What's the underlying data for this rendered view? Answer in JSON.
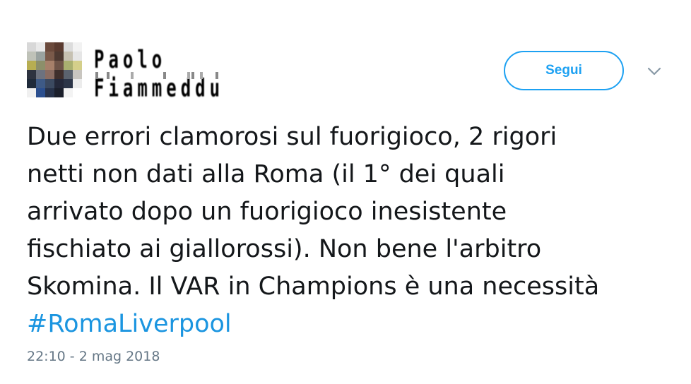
{
  "tweet": {
    "author_name": "Paolo Fiammeddu",
    "follow_label": "Segui",
    "text_lines": [
      "Due errori clamorosi sul fuorigioco, 2 rigori",
      "netti non dati alla Roma (il 1° dei quali",
      "arrivato dopo un fuorigioco inesistente",
      "fischiato ai giallorossi). Non bene l'arbitro",
      "Skomina. Il VAR in Champions è una necessità"
    ],
    "hashtag": "#RomaLiverpool",
    "timestamp": "22:10 - 2 mag 2018"
  },
  "icons": {
    "menu": "chevron-down-icon",
    "avatar": "pixelated-profile-photo"
  },
  "colors": {
    "accent": "#1da1f2",
    "hashtag": "#1b95e0",
    "text": "#14171a",
    "meta": "#657786"
  }
}
